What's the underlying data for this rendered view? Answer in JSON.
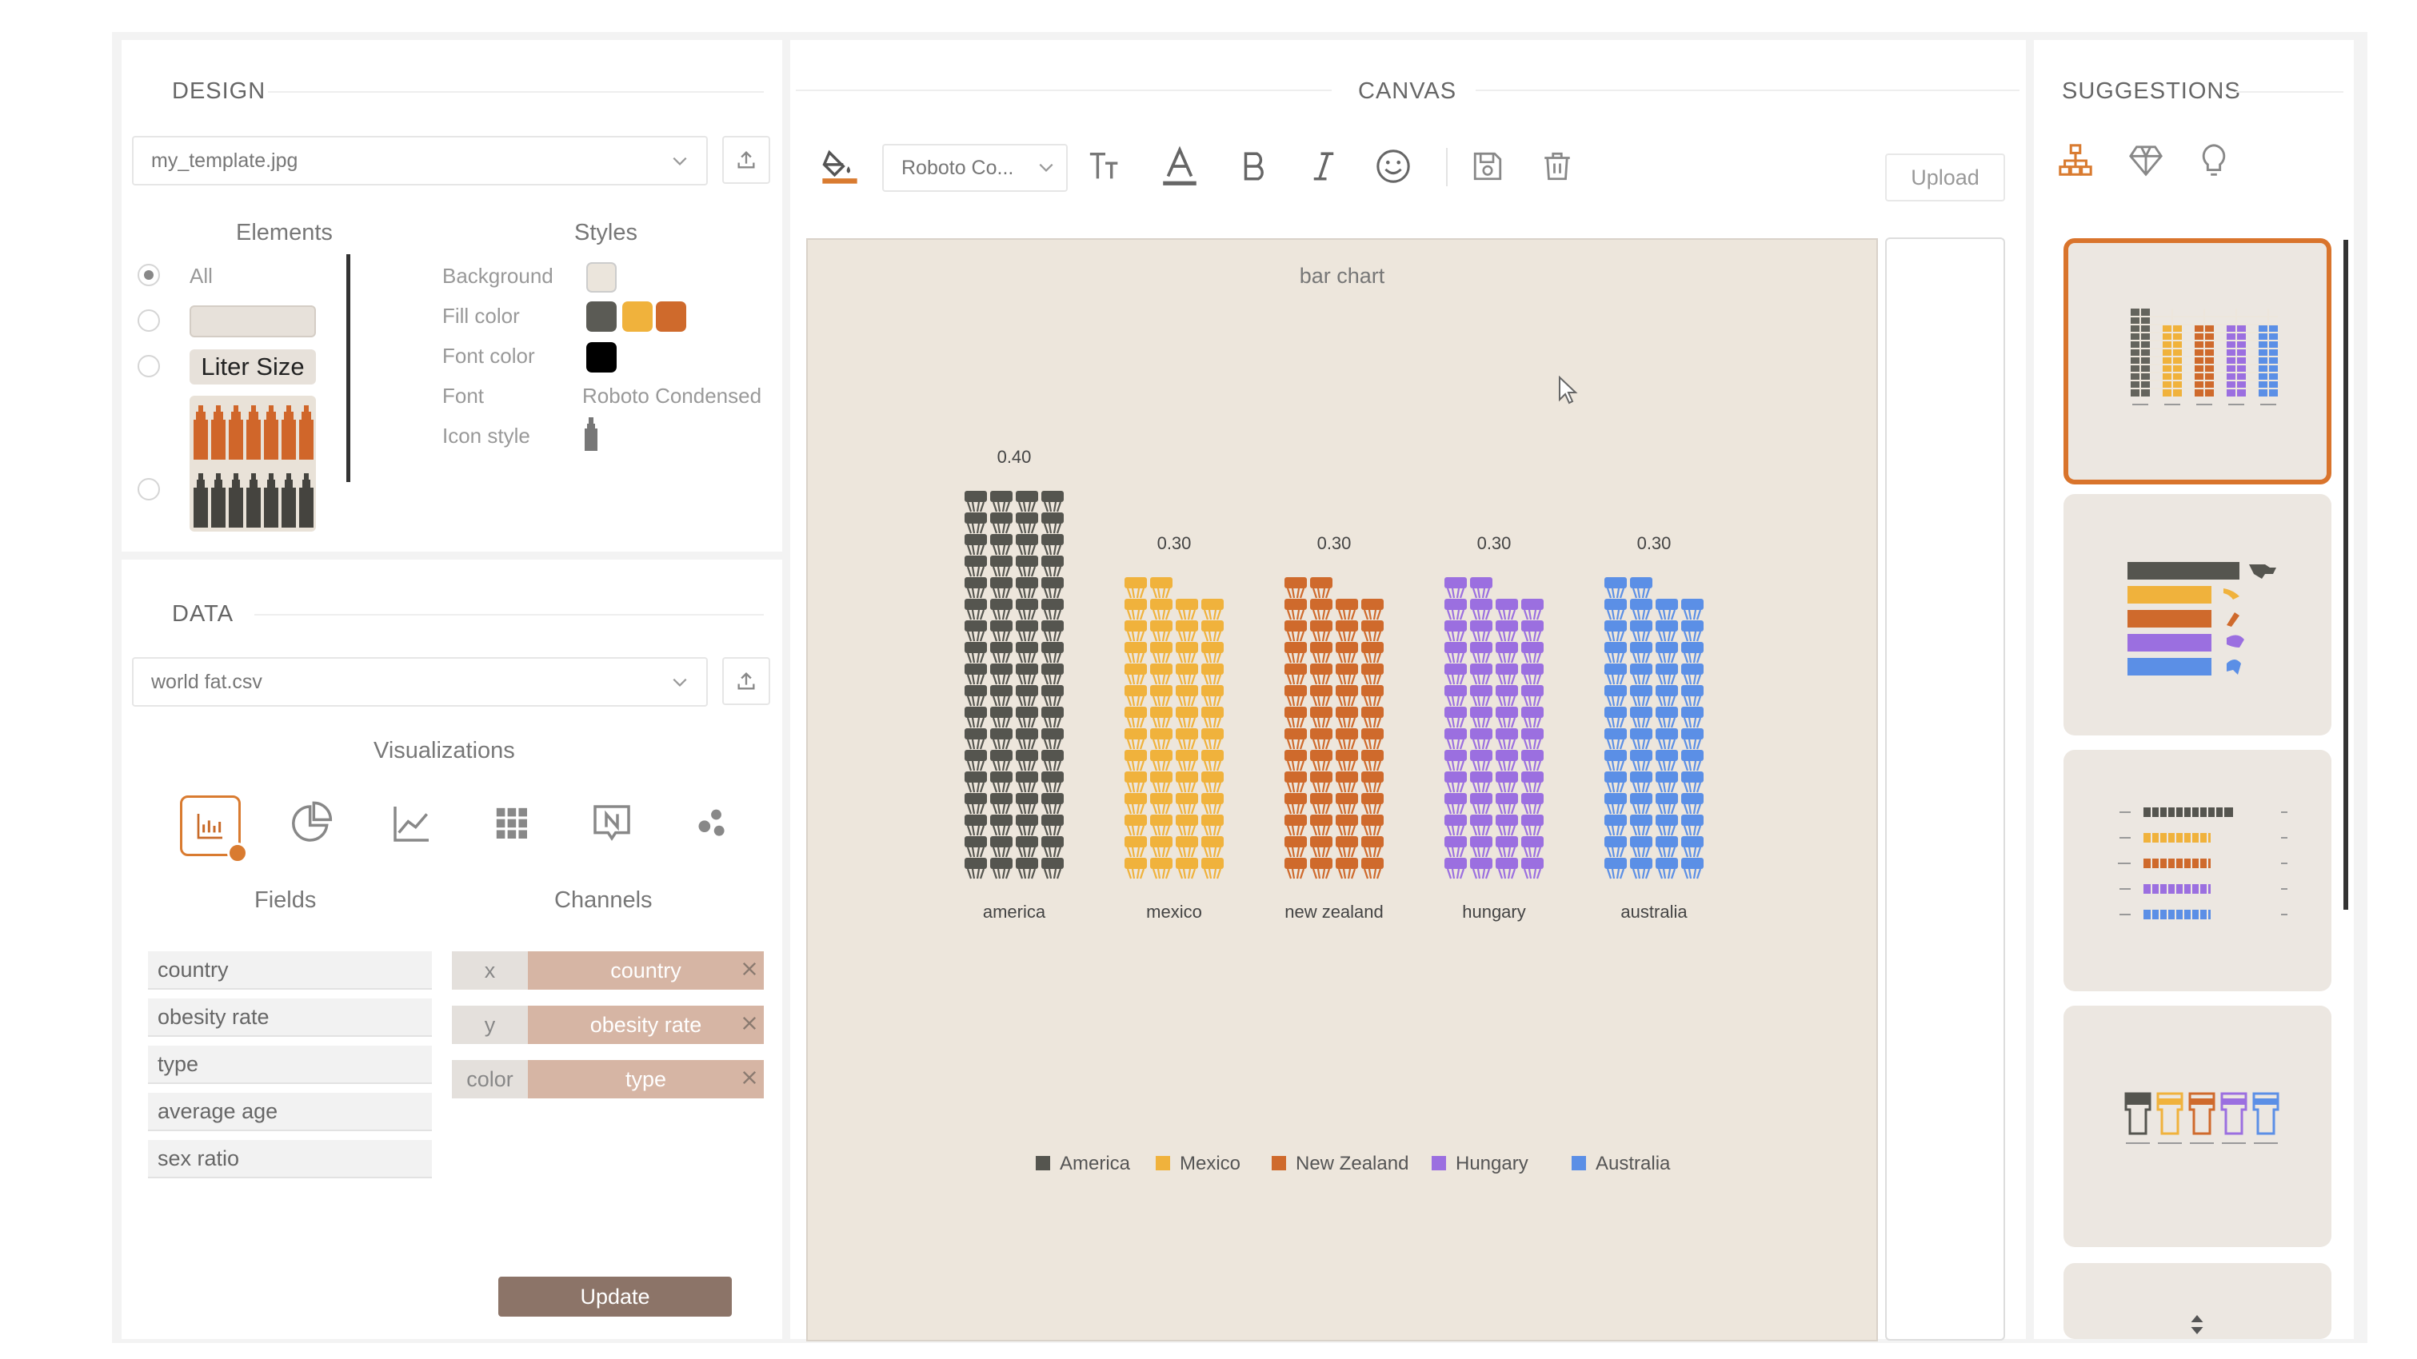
{
  "design": {
    "title": "DESIGN",
    "template_file": "my_template.jpg",
    "elements_header": "Elements",
    "styles_header": "Styles",
    "elements": {
      "all_label": "All",
      "liter_label": "Liter Size"
    },
    "styles": {
      "background_label": "Background",
      "fill_label": "Fill color",
      "font_color_label": "Font color",
      "font_label": "Font",
      "font_value": "Roboto Condensed",
      "icon_style_label": "Icon style",
      "background_color": "#ebe5dc",
      "fill_colors": [
        "#5b5b55",
        "#f0b23c",
        "#cf6a2c"
      ],
      "font_color": "#000000"
    }
  },
  "data": {
    "title": "DATA",
    "data_file": "world fat.csv",
    "viz_header": "Visualizations",
    "viz_icons": [
      "bar-chart-icon",
      "pie-chart-icon",
      "line-chart-icon",
      "grid-icon",
      "number-icon",
      "scatter-icon"
    ],
    "fields_header": "Fields",
    "channels_header": "Channels",
    "fields": [
      "country",
      "obesity rate",
      "type",
      "average age",
      "sex ratio"
    ],
    "channels": [
      {
        "key": "x",
        "value": "country"
      },
      {
        "key": "y",
        "value": "obesity rate"
      },
      {
        "key": "color",
        "value": "type"
      }
    ],
    "update_label": "Update"
  },
  "canvas": {
    "title": "CANVAS",
    "font_select": "Roboto Co...",
    "upload_label": "Upload",
    "background": "#ede6dc"
  },
  "suggestions": {
    "title": "SUGGESTIONS",
    "icons": [
      "hierarchy-icon",
      "diamond-icon",
      "lightbulb-icon"
    ],
    "selected_border": "#d9742c"
  },
  "chart_data": {
    "type": "bar",
    "title": "bar chart",
    "categories": [
      "america",
      "mexico",
      "new zealand",
      "hungary",
      "australia"
    ],
    "values": [
      0.4,
      0.3,
      0.3,
      0.3,
      0.3
    ],
    "value_labels": [
      "0.40",
      "0.30",
      "0.30",
      "0.30",
      "0.30"
    ],
    "legend": [
      "America",
      "Mexico",
      "New Zealand",
      "Hungary",
      "Australia"
    ],
    "legend_position": "bottom",
    "colors": [
      "#55554f",
      "#f0b23c",
      "#cf6a2c",
      "#9b6fe0",
      "#5b8fe6"
    ],
    "icon": "pictogram-icon",
    "grid": false
  }
}
